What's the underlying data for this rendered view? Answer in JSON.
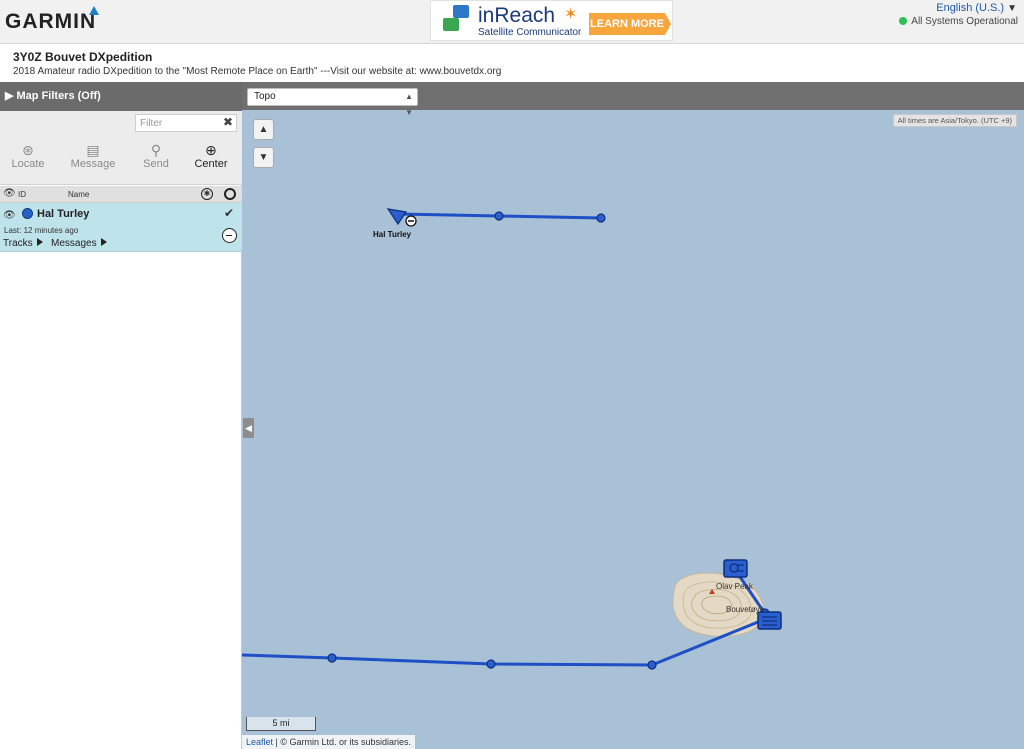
{
  "header": {
    "logo": "GARMIN",
    "ad": {
      "title": "inReach",
      "subtitle": "Satellite Communicator",
      "cta": "LEARN MORE"
    },
    "language": "English (U.S.)",
    "status": "All Systems Operational",
    "status_color": "#2fbf5a"
  },
  "page": {
    "title": "3Y0Z Bouvet DXpedition",
    "subtitle": "2018 Amateur radio DXpedition to the \"Most Remote Place on Earth\" ---Visit our website at: www.bouvetdx.org"
  },
  "sidebar": {
    "filters_label": "Map Filters (Off)",
    "filter_placeholder": "Filter",
    "tools": [
      {
        "label": "Locate",
        "icon": "locate-icon",
        "enabled": false
      },
      {
        "label": "Message",
        "icon": "message-icon",
        "enabled": false
      },
      {
        "label": "Send",
        "icon": "pin-icon",
        "enabled": false
      },
      {
        "label": "Center",
        "icon": "crosshair-icon",
        "enabled": true
      }
    ],
    "columns": {
      "id": "ID",
      "name": "Name"
    },
    "device": {
      "name": "Hal Turley",
      "last": "Last: 12 minutes ago",
      "tracks": "Tracks",
      "messages": "Messages",
      "color": "#2461c6"
    }
  },
  "map": {
    "layer": "Topo",
    "timezone_note": "All times are Asia/Tokyo. (UTC +9)",
    "marker_label": "Hal Turley",
    "island_labels": {
      "peak": "Olav Peak",
      "island": "Bouvetøya"
    },
    "scale": "5 mi",
    "attribution_link": "Leaflet",
    "attribution_text": "| © Garmin Ltd. or its subsidiaries.",
    "track_color": "#1f4fc6",
    "water_color": "#a9c1d6"
  }
}
